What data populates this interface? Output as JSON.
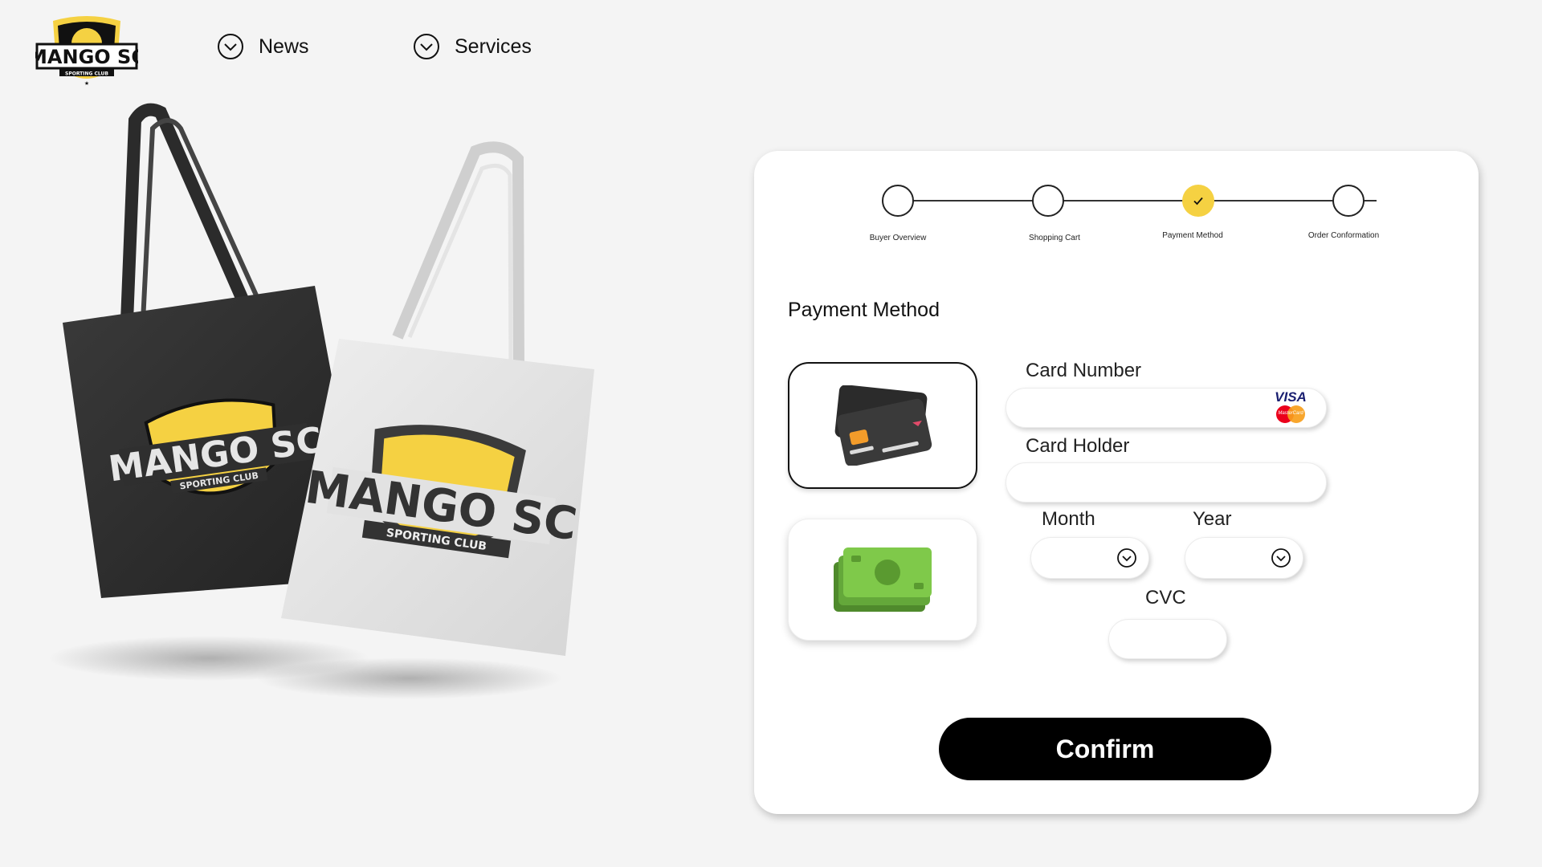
{
  "brand": {
    "logo_name": "MANGO SC",
    "logo_sub": "SPORTING CLUB",
    "accent_color": "#f5d142"
  },
  "nav": {
    "items": [
      {
        "label": "News",
        "icon": "chevron-down-circle-icon"
      },
      {
        "label": "Services",
        "icon": "chevron-down-circle-icon"
      }
    ]
  },
  "product": {
    "bag_dark_text": "MANGO SC",
    "bag_dark_sub": "SPORTING CLUB",
    "bag_light_text": "MANGO SC",
    "bag_light_sub": "SPORTING CLUB"
  },
  "checkout": {
    "steps": [
      {
        "label": "Buyer Overview",
        "completed": false
      },
      {
        "label": "Shopping Cart",
        "completed": false
      },
      {
        "label": "Payment Method",
        "completed": true
      },
      {
        "label": "Order Conformation",
        "completed": false
      }
    ],
    "section_title": "Payment Method",
    "methods": [
      {
        "name": "card",
        "icon": "credit-card-icon",
        "selected": true
      },
      {
        "name": "cash",
        "icon": "cash-icon",
        "selected": false
      }
    ],
    "fields": {
      "card_number": {
        "label": "Card Number",
        "value": ""
      },
      "card_holder": {
        "label": "Card Holder",
        "value": ""
      },
      "month": {
        "label": "Month",
        "value": ""
      },
      "year": {
        "label": "Year",
        "value": ""
      },
      "cvc": {
        "label": "CVC",
        "value": ""
      }
    },
    "card_brands": {
      "visa": "VISA",
      "mastercard": "MasterCard"
    },
    "confirm_label": "Confirm"
  }
}
